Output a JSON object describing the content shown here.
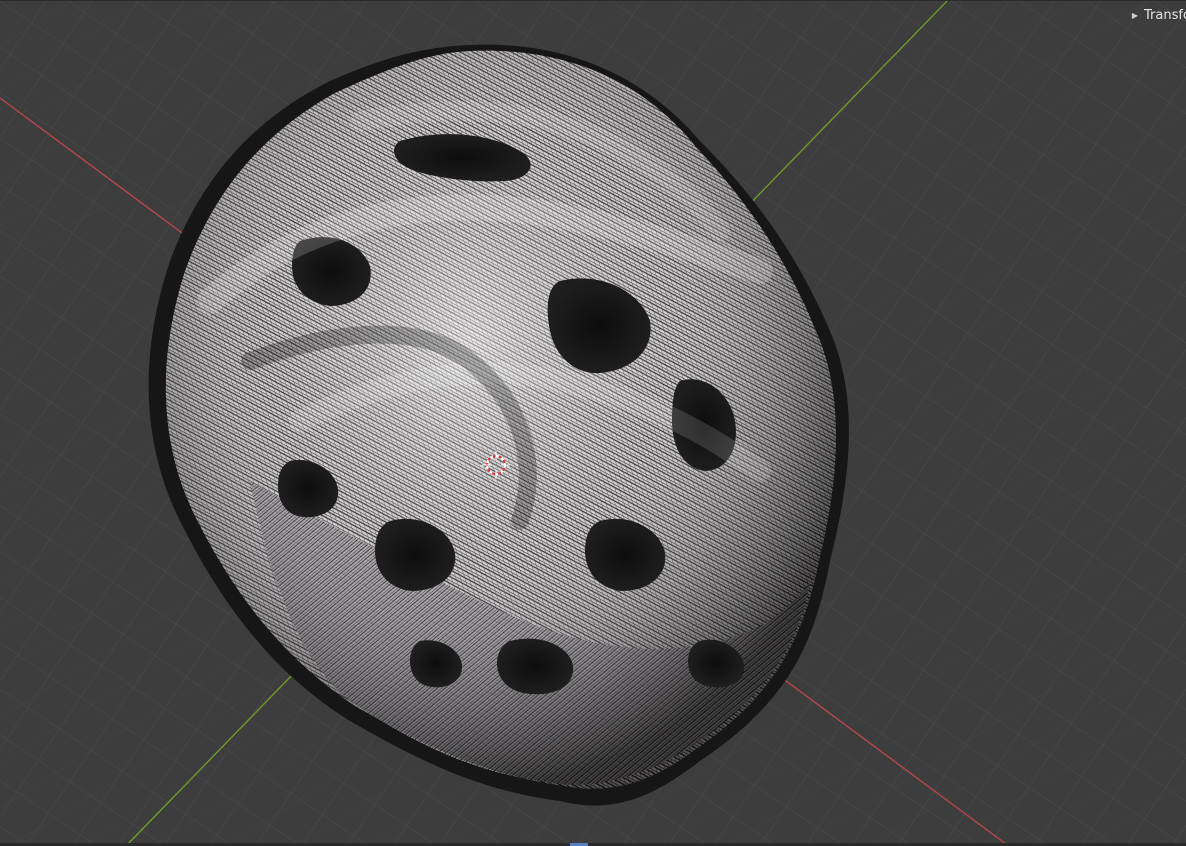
{
  "viewport": {
    "sidebar_toggle": {
      "icon": "triangle-right-icon",
      "label": "Transform"
    }
  },
  "colors": {
    "background": "#3d3d3d",
    "grid": "#4a4a4a",
    "x_axis": "#b5474b",
    "y_axis": "#6f9a2a",
    "cursor_red": "#e03535",
    "mesh_light": "#f4ece4",
    "mesh_shadow": "#121212"
  }
}
